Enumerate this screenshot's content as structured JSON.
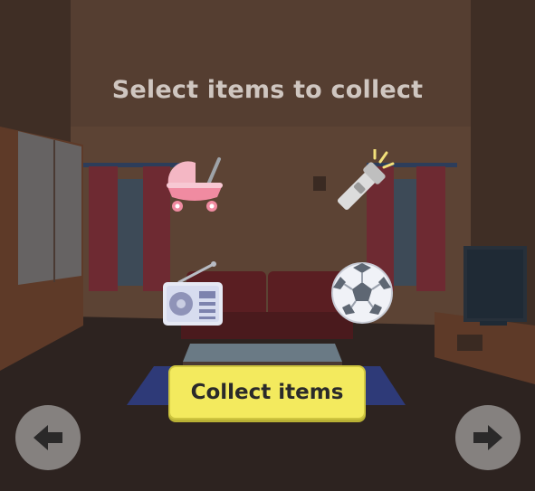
{
  "prompt": {
    "text": "Select items to collect"
  },
  "items": [
    {
      "id": "baby-carriage",
      "label": "baby carriage"
    },
    {
      "id": "flashlight",
      "label": "flashlight"
    },
    {
      "id": "radio",
      "label": "radio"
    },
    {
      "id": "soccer-ball",
      "label": "soccer ball"
    }
  ],
  "actions": {
    "collect_label": "Collect items"
  },
  "navigation": {
    "left_icon": "arrow-left-icon",
    "right_icon": "arrow-right-icon"
  },
  "colors": {
    "button_yellow": "#f3ea5e",
    "wall": "#5a4132",
    "nav_gray": "#8d8a88"
  }
}
